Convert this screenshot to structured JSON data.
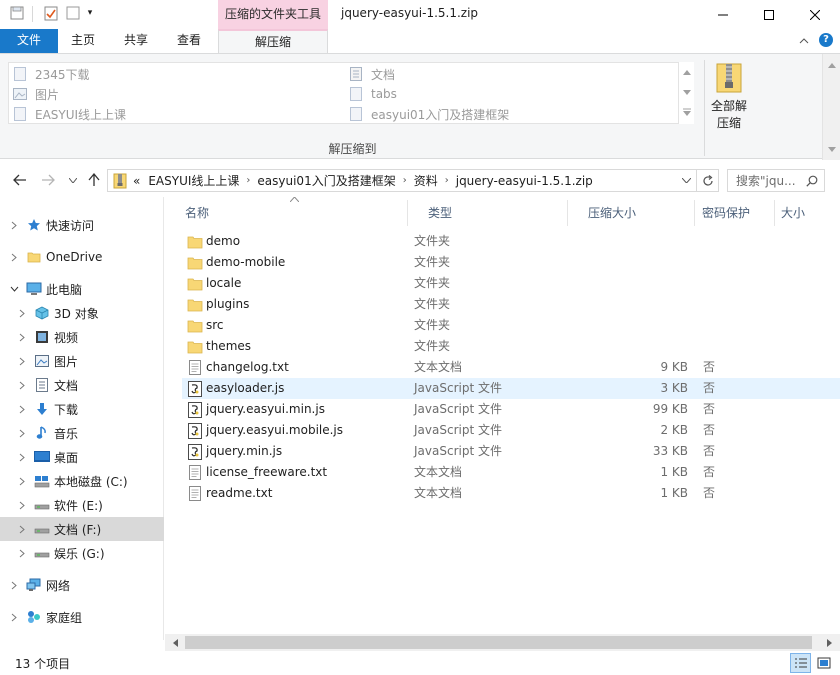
{
  "titlebar": {
    "title": "jquery-easyui-1.5.1.zip",
    "contextual_tab": "压缩的文件夹工具",
    "qa_dropdown": "▾"
  },
  "ribbon_tabs": {
    "file": "文件",
    "home": "主页",
    "share": "共享",
    "view": "查看",
    "extract": "解压缩",
    "help": "?"
  },
  "ribbon": {
    "destinations": [
      {
        "label": "2345下载",
        "icon": "folder-icon"
      },
      {
        "label": "图片",
        "icon": "pictures-icon"
      },
      {
        "label": "EASYUI线上上课",
        "icon": "folder-icon"
      },
      {
        "label": "文档",
        "icon": "documents-icon"
      },
      {
        "label": "tabs",
        "icon": "folder-icon"
      },
      {
        "label": "easyui01入门及搭建框架",
        "icon": "folder-icon"
      }
    ],
    "group_label": "解压缩到",
    "extract_all_line1": "全部解",
    "extract_all_line2": "压缩"
  },
  "address": {
    "overflow": "«",
    "crumbs": [
      "EASYUI线上上课",
      "easyui01入门及搭建框架",
      "资料",
      "jquery-easyui-1.5.1.zip"
    ],
    "search_placeholder": "搜索\"jqu..."
  },
  "nav": {
    "items": [
      {
        "label": "快速访问",
        "icon": "star-icon"
      },
      {
        "label": "OneDrive",
        "icon": "folder-icon"
      },
      {
        "label": "此电脑",
        "icon": "computer-icon"
      },
      {
        "label": "3D 对象",
        "icon": "cube-icon"
      },
      {
        "label": "视频",
        "icon": "video-icon"
      },
      {
        "label": "图片",
        "icon": "pictures-icon"
      },
      {
        "label": "文档",
        "icon": "documents-icon"
      },
      {
        "label": "下载",
        "icon": "download-icon"
      },
      {
        "label": "音乐",
        "icon": "music-icon"
      },
      {
        "label": "桌面",
        "icon": "desktop-icon"
      },
      {
        "label": "本地磁盘 (C:)",
        "icon": "drive-icon"
      },
      {
        "label": "软件 (E:)",
        "icon": "drive-icon"
      },
      {
        "label": "文档 (F:)",
        "icon": "drive-icon"
      },
      {
        "label": "娱乐 (G:)",
        "icon": "drive-icon"
      },
      {
        "label": "网络",
        "icon": "network-icon"
      },
      {
        "label": "家庭组",
        "icon": "homegroup-icon"
      }
    ]
  },
  "columns": {
    "name": "名称",
    "type": "类型",
    "compressed_size": "压缩大小",
    "password": "密码保护",
    "size": "大小"
  },
  "files": [
    {
      "name": "demo",
      "type": "文件夹",
      "size": "",
      "protected": "",
      "icon": "folder-icon"
    },
    {
      "name": "demo-mobile",
      "type": "文件夹",
      "size": "",
      "protected": "",
      "icon": "folder-icon"
    },
    {
      "name": "locale",
      "type": "文件夹",
      "size": "",
      "protected": "",
      "icon": "folder-icon"
    },
    {
      "name": "plugins",
      "type": "文件夹",
      "size": "",
      "protected": "",
      "icon": "folder-icon"
    },
    {
      "name": "src",
      "type": "文件夹",
      "size": "",
      "protected": "",
      "icon": "folder-icon"
    },
    {
      "name": "themes",
      "type": "文件夹",
      "size": "",
      "protected": "",
      "icon": "folder-icon"
    },
    {
      "name": "changelog.txt",
      "type": "文本文档",
      "size": "9 KB",
      "protected": "否",
      "icon": "text-file-icon"
    },
    {
      "name": "easyloader.js",
      "type": "JavaScript 文件",
      "size": "3 KB",
      "protected": "否",
      "icon": "js-file-icon"
    },
    {
      "name": "jquery.easyui.min.js",
      "type": "JavaScript 文件",
      "size": "99 KB",
      "protected": "否",
      "icon": "js-file-icon"
    },
    {
      "name": "jquery.easyui.mobile.js",
      "type": "JavaScript 文件",
      "size": "2 KB",
      "protected": "否",
      "icon": "js-file-icon"
    },
    {
      "name": "jquery.min.js",
      "type": "JavaScript 文件",
      "size": "33 KB",
      "protected": "否",
      "icon": "js-file-icon"
    },
    {
      "name": "license_freeware.txt",
      "type": "文本文档",
      "size": "1 KB",
      "protected": "否",
      "icon": "text-file-icon"
    },
    {
      "name": "readme.txt",
      "type": "文本文档",
      "size": "1 KB",
      "protected": "否",
      "icon": "text-file-icon"
    }
  ],
  "status": {
    "count_text": "13 个项目"
  },
  "colors": {
    "accent": "#1979ca",
    "contextual": "#f8d2e2",
    "selection": "#e5f3ff",
    "folder": "#f8d775"
  }
}
